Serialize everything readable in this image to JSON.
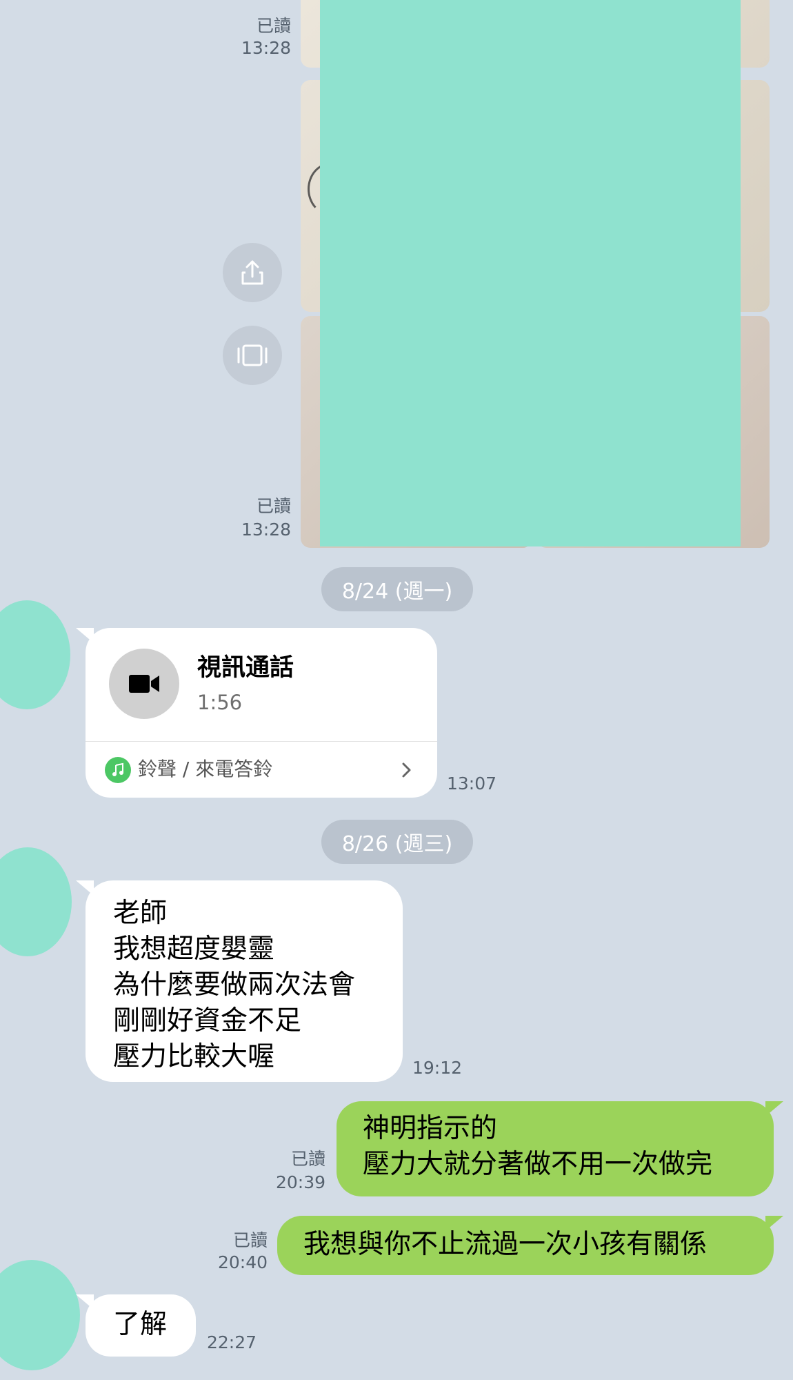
{
  "chat": {
    "photos": {
      "read_top": "已讀",
      "time_top": "13:28",
      "read_bottom": "已讀",
      "time_bottom": "13:28"
    },
    "dates": {
      "aug24": "8/24 (週一)",
      "aug26": "8/26 (週三)"
    },
    "video_call": {
      "title": "視訊通話",
      "duration": "1:56",
      "ringtone_label": "鈴聲 / 來電答鈴",
      "time": "13:07"
    },
    "messages": [
      {
        "side": "left",
        "text": "老師\n我想超度嬰靈\n為什麼要做兩次法會\n剛剛好資金不足\n壓力比較大喔",
        "time": "19:12"
      },
      {
        "side": "right",
        "text": "神明指示的\n壓力大就分著做不用一次做完",
        "read": "已讀",
        "time": "20:39"
      },
      {
        "side": "right",
        "text": "我想與你不止流過一次小孩有關係",
        "read": "已讀",
        "time": "20:40"
      },
      {
        "side": "left",
        "text": "了解",
        "time": "22:27"
      }
    ]
  },
  "colors": {
    "background": "#d3dce6",
    "outgoing_bubble": "#9bd35a",
    "incoming_bubble": "#ffffff",
    "redaction": "#8fe2cf"
  },
  "icons": [
    "share-icon",
    "gallery-icon",
    "video-camera-icon",
    "music-note-icon",
    "chevron-right-icon"
  ]
}
